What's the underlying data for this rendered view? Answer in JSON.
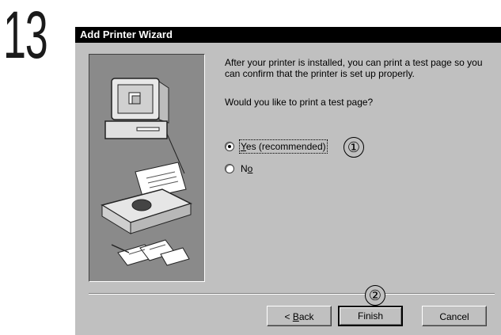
{
  "step_number": "13",
  "dialog": {
    "title": "Add Printer Wizard",
    "intro_text": "After your printer is installed, you can print a test page so you can confirm that the printer is set up properly.",
    "question": "Would you like to print a test page?",
    "options": [
      {
        "mnemonic": "Y",
        "rest": "es (recommended)",
        "selected": true
      },
      {
        "prefix": "N",
        "mnemonic": "o",
        "selected": false
      }
    ],
    "buttons": {
      "back_prefix": "< ",
      "back_mnemonic": "B",
      "back_rest": "ack",
      "finish": "Finish",
      "cancel": "Cancel"
    }
  },
  "callouts": [
    "①",
    "②"
  ],
  "illustration_icons": [
    "computer-monitor-icon",
    "printer-icon",
    "printed-pages-icon"
  ]
}
